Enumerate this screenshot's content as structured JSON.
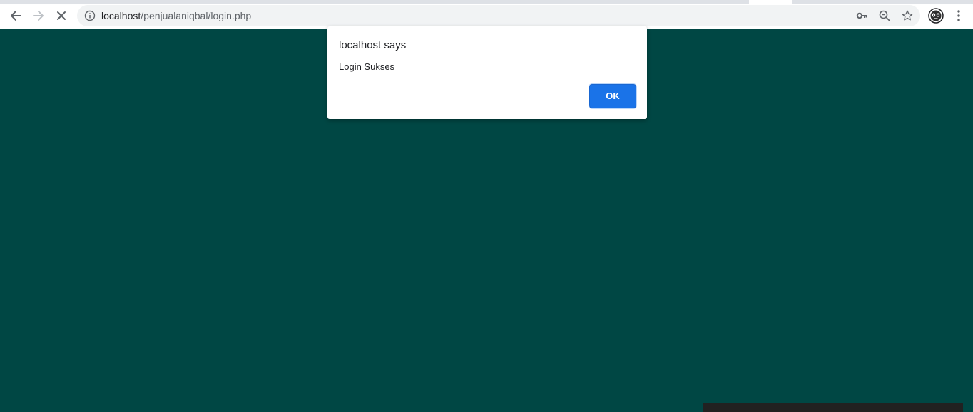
{
  "browser": {
    "url_host": "localhost",
    "url_path": "/penjualaniqbal/login.php"
  },
  "toolbar_icons": {
    "back": "arrow-back-icon",
    "forward": "arrow-forward-icon",
    "stop": "stop-loading-icon",
    "info": "info-icon",
    "key": "key-icon",
    "zoom": "zoom-out-icon",
    "star": "star-icon",
    "avatar": "profile-avatar",
    "menu": "kebab-menu-icon"
  },
  "dialog": {
    "title": "localhost says",
    "message": "Login Sukses",
    "ok_label": "OK"
  },
  "colors": {
    "page_background": "#004744",
    "accent": "#1a73e8"
  }
}
